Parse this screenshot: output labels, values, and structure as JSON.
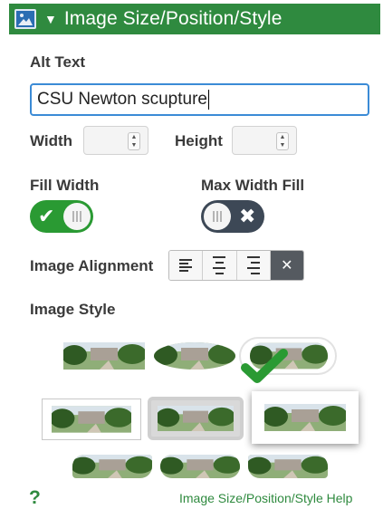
{
  "header": {
    "title": "Image Size/Position/Style",
    "icon": "image-icon",
    "caret_icon": "caret-down-icon",
    "background": "#2f8a3f"
  },
  "alt_text": {
    "label": "Alt Text",
    "value": "CSU Newton scupture"
  },
  "size": {
    "width_label": "Width",
    "width_value": "",
    "height_label": "Height",
    "height_value": ""
  },
  "fill_width": {
    "label": "Fill Width",
    "state": true
  },
  "max_width_fill": {
    "label": "Max Width Fill",
    "state": false
  },
  "alignment": {
    "label": "Image Alignment",
    "options": [
      "align-left-icon",
      "align-center-icon",
      "align-right-icon",
      "clear-icon"
    ],
    "selected": "clear-icon"
  },
  "image_style": {
    "label": "Image Style",
    "styles": [
      "plain",
      "oval",
      "rounded-pill",
      "bordered",
      "rounded-border",
      "shadow",
      "rounded-edge-1",
      "rounded-edge-2",
      "rounded-edge-3"
    ],
    "selected": "rounded-pill",
    "check_color": "#2a9a33"
  },
  "help": {
    "icon_label": "?",
    "link_label": "Image Size/Position/Style Help"
  }
}
